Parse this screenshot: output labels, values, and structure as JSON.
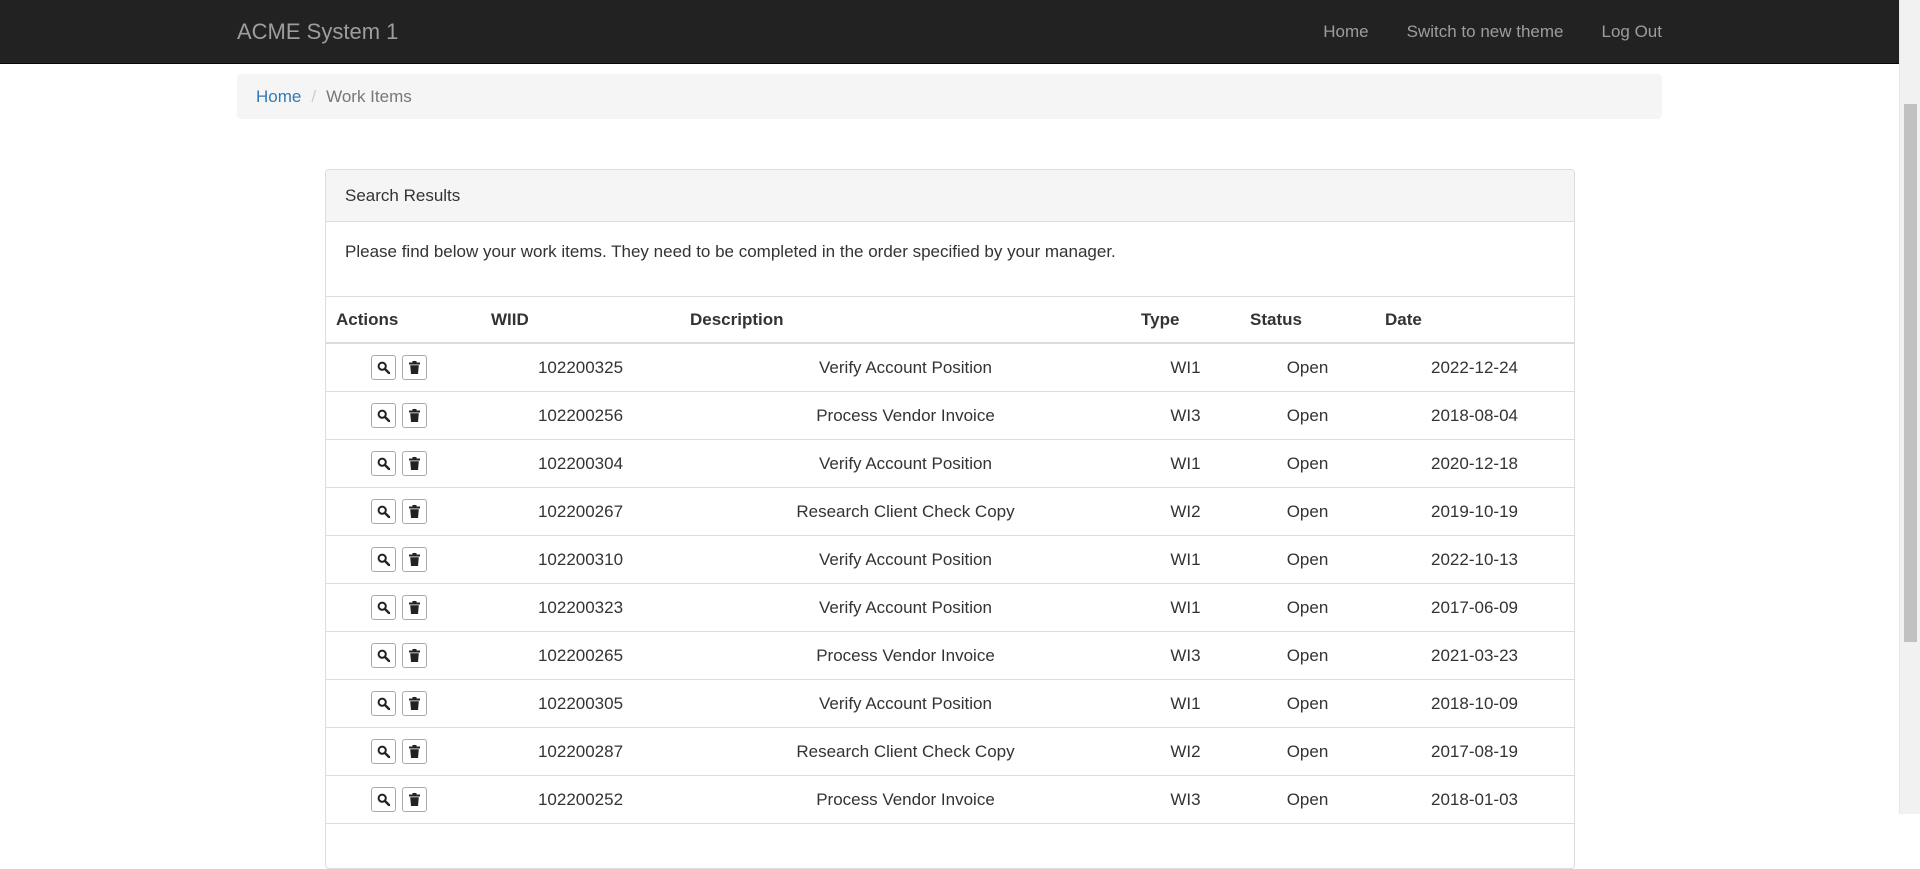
{
  "navbar": {
    "brand": "ACME System 1",
    "links": [
      "Home",
      "Switch to new theme",
      "Log Out"
    ]
  },
  "breadcrumb": {
    "home": "Home",
    "current": "Work Items"
  },
  "panel": {
    "heading": "Search Results",
    "intro": "Please find below your work items. They need to be completed in the order specified by your manager."
  },
  "table": {
    "headers": [
      "Actions",
      "WIID",
      "Description",
      "Type",
      "Status",
      "Date"
    ],
    "rows": [
      {
        "wiid": "102200325",
        "description": "Verify Account Position",
        "type": "WI1",
        "status": "Open",
        "date": "2022-12-24"
      },
      {
        "wiid": "102200256",
        "description": "Process Vendor Invoice",
        "type": "WI3",
        "status": "Open",
        "date": "2018-08-04"
      },
      {
        "wiid": "102200304",
        "description": "Verify Account Position",
        "type": "WI1",
        "status": "Open",
        "date": "2020-12-18"
      },
      {
        "wiid": "102200267",
        "description": "Research Client Check Copy",
        "type": "WI2",
        "status": "Open",
        "date": "2019-10-19"
      },
      {
        "wiid": "102200310",
        "description": "Verify Account Position",
        "type": "WI1",
        "status": "Open",
        "date": "2022-10-13"
      },
      {
        "wiid": "102200323",
        "description": "Verify Account Position",
        "type": "WI1",
        "status": "Open",
        "date": "2017-06-09"
      },
      {
        "wiid": "102200265",
        "description": "Process Vendor Invoice",
        "type": "WI3",
        "status": "Open",
        "date": "2021-03-23"
      },
      {
        "wiid": "102200305",
        "description": "Verify Account Position",
        "type": "WI1",
        "status": "Open",
        "date": "2018-10-09"
      },
      {
        "wiid": "102200287",
        "description": "Research Client Check Copy",
        "type": "WI2",
        "status": "Open",
        "date": "2017-08-19"
      },
      {
        "wiid": "102200252",
        "description": "Process Vendor Invoice",
        "type": "WI3",
        "status": "Open",
        "date": "2018-01-03"
      }
    ],
    "row_icons": [
      "search-icon",
      "trash-icon"
    ]
  }
}
